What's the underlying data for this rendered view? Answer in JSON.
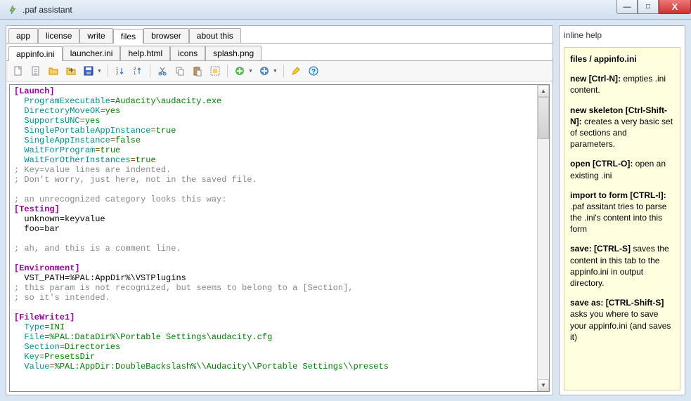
{
  "window": {
    "title": ".paf assistant"
  },
  "win_controls": {
    "min": "—",
    "max": "□",
    "close": "X"
  },
  "tabs_primary": [
    {
      "label": "app",
      "active": false
    },
    {
      "label": "license",
      "active": false
    },
    {
      "label": "write",
      "active": false
    },
    {
      "label": "files",
      "active": true
    },
    {
      "label": "browser",
      "active": false
    },
    {
      "label": "about this",
      "active": false
    }
  ],
  "tabs_secondary": [
    {
      "label": "appinfo.ini",
      "active": true
    },
    {
      "label": "launcher.ini",
      "active": false
    },
    {
      "label": "help.html",
      "active": false
    },
    {
      "label": "icons",
      "active": false
    },
    {
      "label": "splash.png",
      "active": false
    }
  ],
  "toolbar_icons": [
    "new-file-icon",
    "new-skeleton-icon",
    "open-icon",
    "import-icon",
    "save-icon",
    "sep",
    "sort-asc-icon",
    "sort-desc-icon",
    "sep",
    "cut-icon",
    "copy-icon",
    "paste-icon",
    "select-all-icon",
    "sep",
    "add-icon",
    "add-section-icon",
    "sep",
    "highlight-icon",
    "help-icon"
  ],
  "editor_lines": [
    {
      "type": "section",
      "text": "[Launch]"
    },
    {
      "type": "kv",
      "indent": 1,
      "key": "ProgramExecutable",
      "val": "Audacity\\audacity.exe"
    },
    {
      "type": "kv",
      "indent": 1,
      "key": "DirectoryMoveOK",
      "val": "yes"
    },
    {
      "type": "kv",
      "indent": 1,
      "key": "SupportsUNC",
      "val": "yes"
    },
    {
      "type": "kv",
      "indent": 1,
      "key": "SinglePortableAppInstance",
      "val": "true"
    },
    {
      "type": "kv",
      "indent": 1,
      "key": "SingleAppInstance",
      "val": "false"
    },
    {
      "type": "kv",
      "indent": 1,
      "key": "WaitForProgram",
      "val": "true"
    },
    {
      "type": "kv",
      "indent": 1,
      "key": "WaitForOtherInstances",
      "val": "true"
    },
    {
      "type": "comment",
      "text": "; Key=value lines are indented."
    },
    {
      "type": "comment",
      "text": "; Don't worry, just here, not in the saved file."
    },
    {
      "type": "blank"
    },
    {
      "type": "comment",
      "text": "; an unrecognized category looks this way:"
    },
    {
      "type": "section",
      "text": "[Testing]"
    },
    {
      "type": "kvplain",
      "indent": 1,
      "key": "unknown",
      "val": "keyvalue"
    },
    {
      "type": "kvplain",
      "indent": 1,
      "key": "foo",
      "val": "bar"
    },
    {
      "type": "blank"
    },
    {
      "type": "comment",
      "text": "; ah, and this is a comment line."
    },
    {
      "type": "blank"
    },
    {
      "type": "section",
      "text": "[Environment]"
    },
    {
      "type": "kvplain",
      "indent": 1,
      "key": "VST_PATH",
      "val": "%PAL:AppDir%\\VSTPlugins"
    },
    {
      "type": "comment",
      "text": "; this param is not recognized, but seems to belong to a [Section],"
    },
    {
      "type": "comment",
      "text": "; so it's intended."
    },
    {
      "type": "blank"
    },
    {
      "type": "section",
      "text": "[FileWrite1]"
    },
    {
      "type": "kv",
      "indent": 1,
      "key": "Type",
      "val": "INI"
    },
    {
      "type": "kv",
      "indent": 1,
      "key": "File",
      "val": "%PAL:DataDir%\\Portable Settings\\audacity.cfg"
    },
    {
      "type": "kv",
      "indent": 1,
      "key": "Section",
      "val": "Directories"
    },
    {
      "type": "kv",
      "indent": 1,
      "key": "Key",
      "val": "PresetsDir"
    },
    {
      "type": "kv",
      "indent": 1,
      "key": "Value",
      "val": "%PAL:AppDir:DoubleBackslash%\\\\Audacity\\\\Portable Settings\\\\presets"
    }
  ],
  "side": {
    "header": "inline help",
    "title": "files / appinfo.ini",
    "items": [
      {
        "bold": "new [Ctrl-N]:",
        "text": " empties .ini content."
      },
      {
        "bold": "new skeleton [Ctrl-Shift-N]:",
        "text": " creates a very basic set of sections and parameters."
      },
      {
        "bold": "open [CTRL-O]:",
        "text": " open an existing .ini"
      },
      {
        "bold": "import to form [CTRL-I]:",
        "text": " .paf assitant tries to parse the .ini's content into this form"
      },
      {
        "bold": "save: [CTRL-S]",
        "text": " saves the content in this tab to the appinfo.ini in output directory."
      },
      {
        "bold": "save as: [CTRL-Shift-S]",
        "text": " asks you where to save your appinfo.ini (and saves it)"
      }
    ]
  }
}
